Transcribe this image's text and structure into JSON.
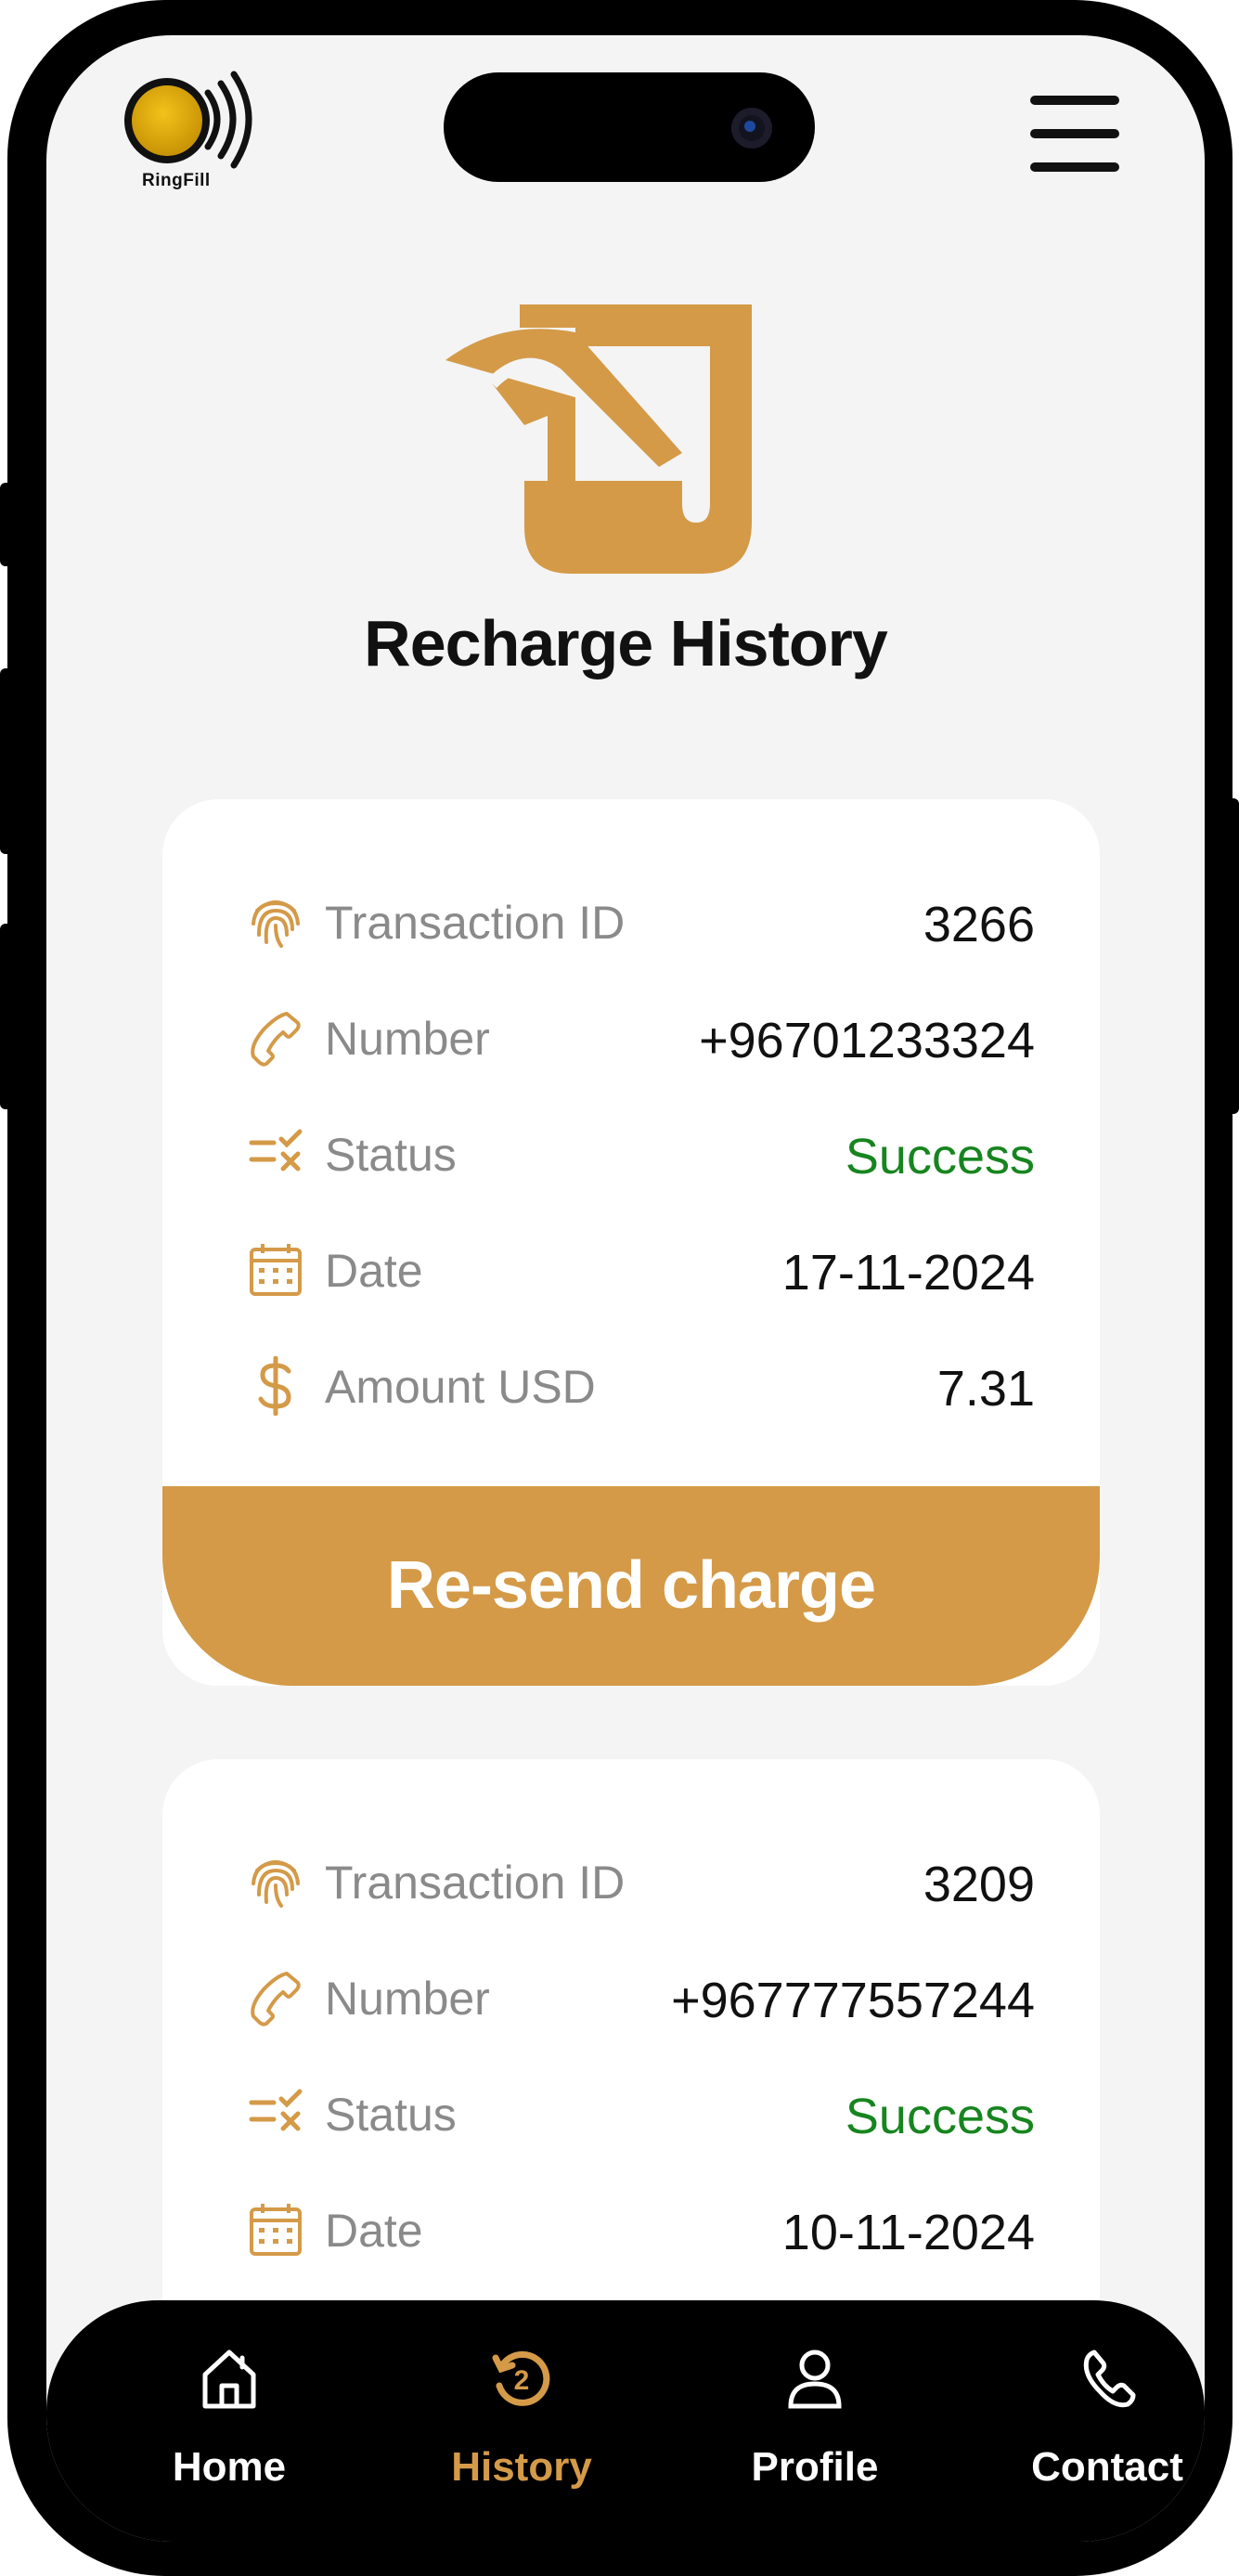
{
  "app": {
    "logo_text": "RingFill"
  },
  "page": {
    "title": "Recharge History"
  },
  "colors": {
    "accent": "#d49a48",
    "success": "#17851f",
    "nav_bg": "#000000"
  },
  "labels": {
    "transaction_id": "Transaction ID",
    "number": "Number",
    "status": "Status",
    "date": "Date",
    "amount": "Amount USD"
  },
  "records": [
    {
      "transaction_id": "3266",
      "number": "+96701233324",
      "status": "Success",
      "date": "17-11-2024",
      "amount": "7.31",
      "action_label": "Re-send charge"
    },
    {
      "transaction_id": "3209",
      "number": "+967777557244",
      "status": "Success",
      "date": "10-11-2024"
    }
  ],
  "nav": {
    "items": [
      {
        "label": "Home",
        "icon": "home-icon"
      },
      {
        "label": "History",
        "icon": "history-icon",
        "active": true
      },
      {
        "label": "Profile",
        "icon": "profile-icon"
      },
      {
        "label": "Contact",
        "icon": "phone-icon"
      }
    ]
  }
}
